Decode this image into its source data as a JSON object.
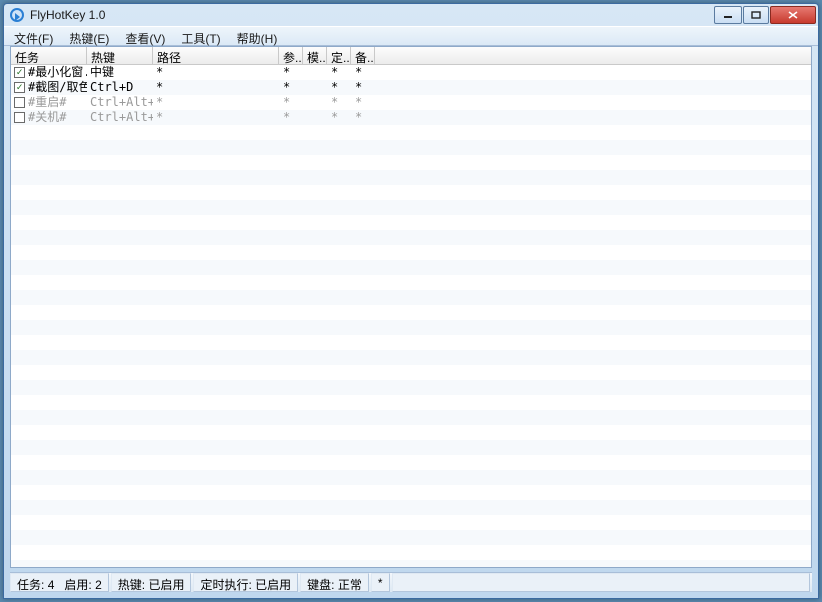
{
  "window": {
    "title": "FlyHotKey 1.0"
  },
  "menu": {
    "file": "文件(F)",
    "hotkey": "热键(E)",
    "view": "查看(V)",
    "tools": "工具(T)",
    "help": "帮助(H)"
  },
  "columns": {
    "task": "任务",
    "hotkey": "热键",
    "path": "路径",
    "arg": "参..",
    "mode": "模..",
    "timer": "定..",
    "remark": "备.."
  },
  "rows": [
    {
      "enabled": true,
      "task": "#最小化窗..",
      "hotkey": "中键",
      "path": "*",
      "arg": "*",
      "mode": "",
      "timer": "*",
      "remark": "*"
    },
    {
      "enabled": true,
      "task": "#截图/取色#",
      "hotkey": "Ctrl+D",
      "path": "*",
      "arg": "*",
      "mode": "",
      "timer": "*",
      "remark": "*"
    },
    {
      "enabled": false,
      "task": "#重启#",
      "hotkey": "Ctrl+Alt+Home",
      "path": "*",
      "arg": "*",
      "mode": "",
      "timer": "*",
      "remark": "*"
    },
    {
      "enabled": false,
      "task": "#关机#",
      "hotkey": "Ctrl+Alt+End",
      "path": "*",
      "arg": "*",
      "mode": "",
      "timer": "*",
      "remark": "*"
    }
  ],
  "status": {
    "tasks_label": "任务:",
    "tasks_count": "4",
    "enabled_label": "启用:",
    "enabled_count": "2",
    "hotkey_label": "热键:",
    "hotkey_state": "已启用",
    "timer_label": "定时执行:",
    "timer_state": "已启用",
    "keyboard_label": "键盘:",
    "keyboard_state": "正常",
    "extra": "*"
  }
}
